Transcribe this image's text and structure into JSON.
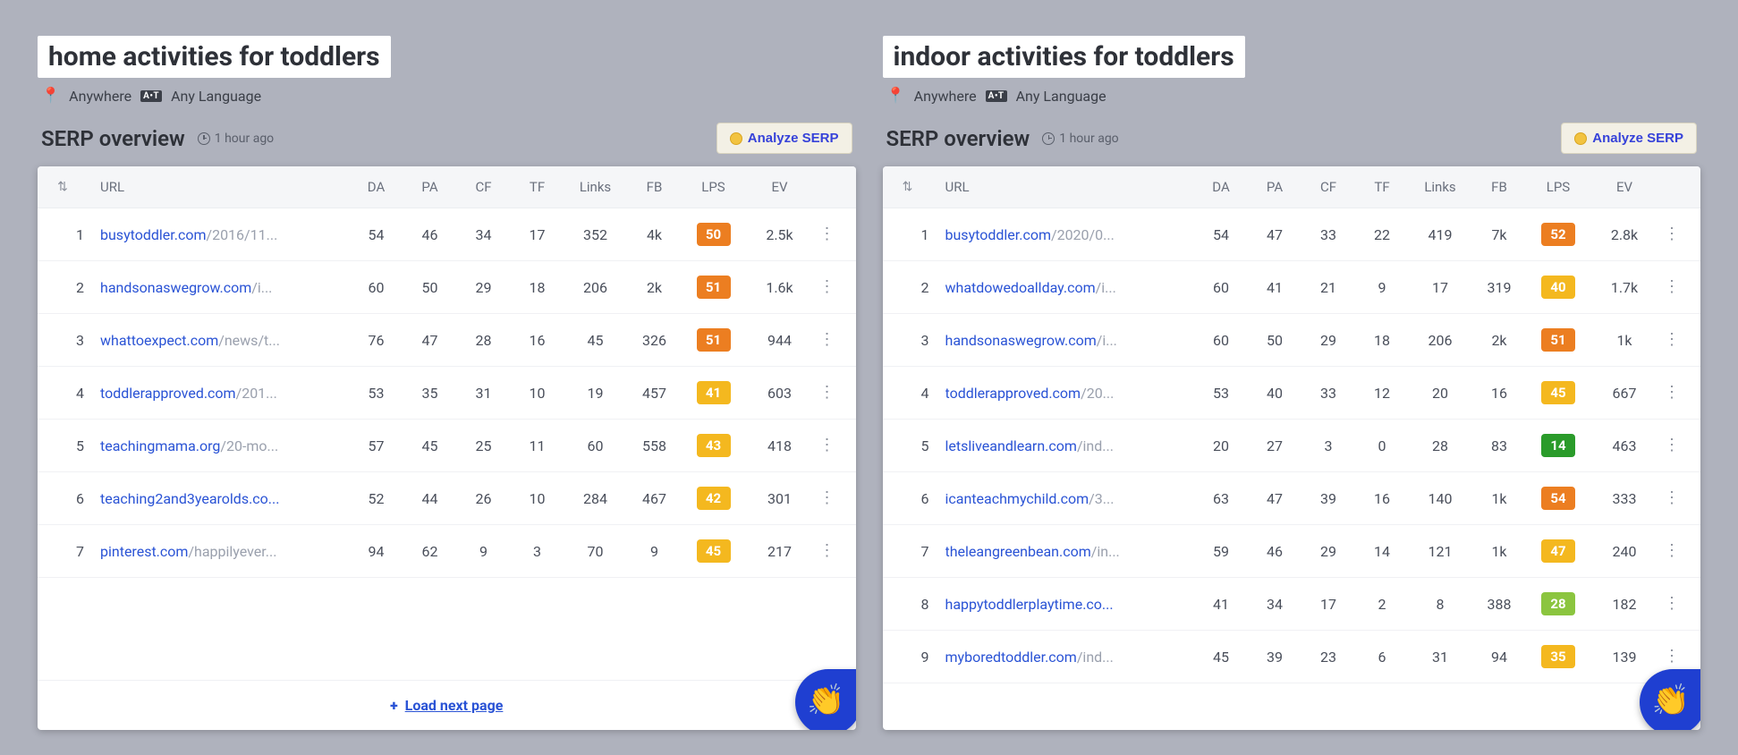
{
  "common": {
    "location_label": "Anywhere",
    "language_label": "Any Language",
    "serp_overview_label": "SERP overview",
    "time_ago": "1 hour ago",
    "analyze_label": "Analyze SERP",
    "load_next_label": "Load next page",
    "lang_badge": "A•T",
    "headers": {
      "url": "URL",
      "da": "DA",
      "pa": "PA",
      "cf": "CF",
      "tf": "TF",
      "links": "Links",
      "fb": "FB",
      "lps": "LPS",
      "ev": "EV"
    }
  },
  "panels": [
    {
      "keyword": "home activities for toddlers",
      "show_load_more": true,
      "rows": [
        {
          "rank": 1,
          "domain": "busytoddler.com",
          "path": "/2016/11...",
          "da": 54,
          "pa": 46,
          "cf": 34,
          "tf": 17,
          "links": "352",
          "fb": "4k",
          "lps": 50,
          "lps_color": "orange",
          "ev": "2.5k"
        },
        {
          "rank": 2,
          "domain": "handsonaswegrow.com",
          "path": "/i...",
          "da": 60,
          "pa": 50,
          "cf": 29,
          "tf": 18,
          "links": "206",
          "fb": "2k",
          "lps": 51,
          "lps_color": "orange",
          "ev": "1.6k"
        },
        {
          "rank": 3,
          "domain": "whattoexpect.com",
          "path": "/news/t...",
          "da": 76,
          "pa": 47,
          "cf": 28,
          "tf": 16,
          "links": "45",
          "fb": "326",
          "lps": 51,
          "lps_color": "orange",
          "ev": "944"
        },
        {
          "rank": 4,
          "domain": "toddlerapproved.com",
          "path": "/201...",
          "da": 53,
          "pa": 35,
          "cf": 31,
          "tf": 10,
          "links": "19",
          "fb": "457",
          "lps": 41,
          "lps_color": "amber",
          "ev": "603"
        },
        {
          "rank": 5,
          "domain": "teachingmama.org",
          "path": "/20-mo...",
          "da": 57,
          "pa": 45,
          "cf": 25,
          "tf": 11,
          "links": "60",
          "fb": "558",
          "lps": 43,
          "lps_color": "amber",
          "ev": "418"
        },
        {
          "rank": 6,
          "domain": "teaching2and3yearolds.co...",
          "path": "",
          "da": 52,
          "pa": 44,
          "cf": 26,
          "tf": 10,
          "links": "284",
          "fb": "467",
          "lps": 42,
          "lps_color": "amber",
          "ev": "301"
        },
        {
          "rank": 7,
          "domain": "pinterest.com",
          "path": "/happilyever...",
          "da": 94,
          "pa": 62,
          "cf": 9,
          "tf": 3,
          "links": "70",
          "fb": "9",
          "lps": 45,
          "lps_color": "amber",
          "ev": "217"
        }
      ]
    },
    {
      "keyword": "indoor activities for toddlers",
      "show_load_more": false,
      "rows": [
        {
          "rank": 1,
          "domain": "busytoddler.com",
          "path": "/2020/0...",
          "da": 54,
          "pa": 47,
          "cf": 33,
          "tf": 22,
          "links": "419",
          "fb": "7k",
          "lps": 52,
          "lps_color": "orange",
          "ev": "2.8k"
        },
        {
          "rank": 2,
          "domain": "whatdowedoallday.com",
          "path": "/i...",
          "da": 60,
          "pa": 41,
          "cf": 21,
          "tf": 9,
          "links": "17",
          "fb": "319",
          "lps": 40,
          "lps_color": "amber",
          "ev": "1.7k"
        },
        {
          "rank": 3,
          "domain": "handsonaswegrow.com",
          "path": "/i...",
          "da": 60,
          "pa": 50,
          "cf": 29,
          "tf": 18,
          "links": "206",
          "fb": "2k",
          "lps": 51,
          "lps_color": "orange",
          "ev": "1k"
        },
        {
          "rank": 4,
          "domain": "toddlerapproved.com",
          "path": "/20...",
          "da": 53,
          "pa": 40,
          "cf": 33,
          "tf": 12,
          "links": "20",
          "fb": "16",
          "lps": 45,
          "lps_color": "amber",
          "ev": "667"
        },
        {
          "rank": 5,
          "domain": "letsliveandlearn.com",
          "path": "/ind...",
          "da": 20,
          "pa": 27,
          "cf": 3,
          "tf": 0,
          "links": "28",
          "fb": "83",
          "lps": 14,
          "lps_color": "green",
          "ev": "463"
        },
        {
          "rank": 6,
          "domain": "icanteachmychild.com",
          "path": "/3...",
          "da": 63,
          "pa": 47,
          "cf": 39,
          "tf": 16,
          "links": "140",
          "fb": "1k",
          "lps": 54,
          "lps_color": "orange",
          "ev": "333"
        },
        {
          "rank": 7,
          "domain": "theleangreenbean.com",
          "path": "/in...",
          "da": 59,
          "pa": 46,
          "cf": 29,
          "tf": 14,
          "links": "121",
          "fb": "1k",
          "lps": 47,
          "lps_color": "amber",
          "ev": "240"
        },
        {
          "rank": 8,
          "domain": "happytoddlerplaytime.co...",
          "path": "",
          "da": 41,
          "pa": 34,
          "cf": 17,
          "tf": 2,
          "links": "8",
          "fb": "388",
          "lps": 28,
          "lps_color": "lime",
          "ev": "182"
        },
        {
          "rank": 9,
          "domain": "myboredtoddler.com",
          "path": "/ind...",
          "da": 45,
          "pa": 39,
          "cf": 23,
          "tf": 6,
          "links": "31",
          "fb": "94",
          "lps": 35,
          "lps_color": "amber",
          "ev": "139"
        }
      ]
    }
  ]
}
